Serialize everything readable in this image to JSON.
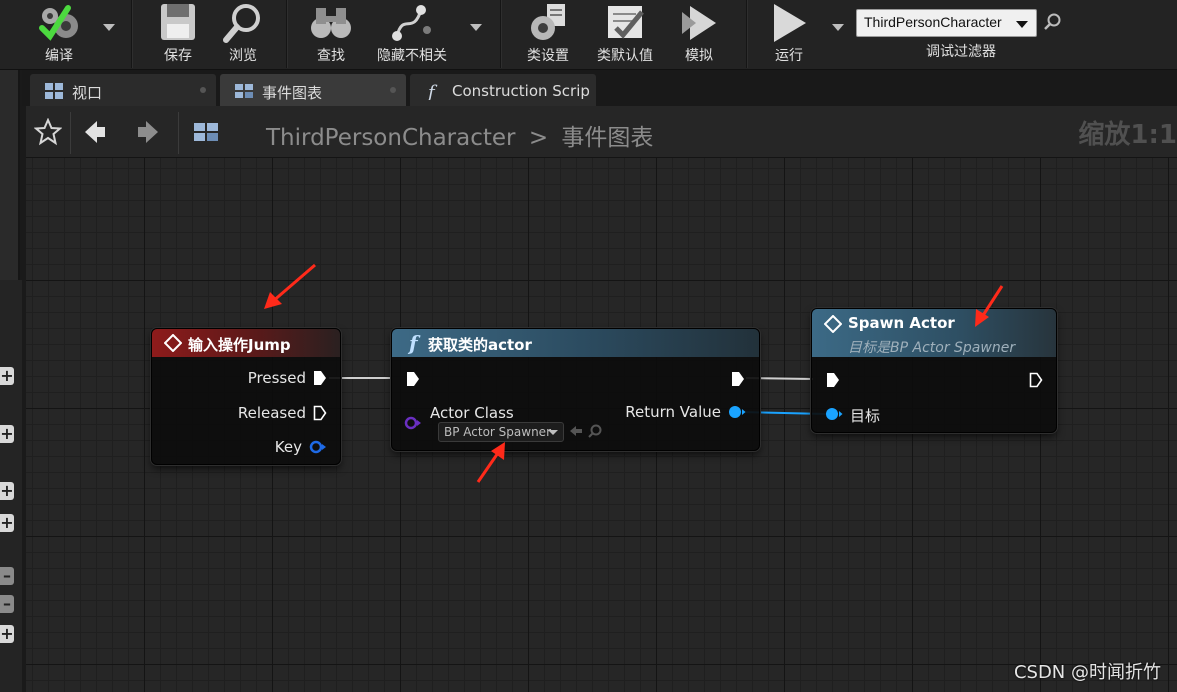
{
  "toolbar": {
    "compile": "编译",
    "save": "保存",
    "browse": "浏览",
    "find": "查找",
    "hide_unrelated": "隐藏不相关",
    "class_settings": "类设置",
    "class_defaults": "类默认值",
    "simulate": "模拟",
    "play": "运行",
    "debug_filter_value": "ThirdPersonCharacter",
    "debug_filter_label": "调试过滤器"
  },
  "tabs": [
    {
      "label": "视口",
      "icon": "viewport-icon"
    },
    {
      "label": "事件图表",
      "icon": "event-graph-icon"
    },
    {
      "label": "Construction Scrip",
      "icon": "function-icon"
    }
  ],
  "breadcrumb": {
    "root": "ThirdPersonCharacter",
    "separator": ">",
    "current": "事件图表",
    "zoom": "缩放1:1"
  },
  "nodes": {
    "input_jump": {
      "title": "输入操作Jump",
      "pins": {
        "pressed": "Pressed",
        "released": "Released",
        "key": "Key"
      }
    },
    "get_class_actor": {
      "title": "获取类的actor",
      "pins": {
        "actor_class": "Actor Class",
        "return_value": "Return Value"
      },
      "class_value": "BP Actor Spawner"
    },
    "spawn_actor": {
      "title": "Spawn Actor",
      "subtitle": "目标是BP Actor Spawner",
      "pins": {
        "target": "目标"
      }
    }
  },
  "colors": {
    "exec_pin": "#ffffff",
    "object_pin": "#1aa3ff",
    "class_pin": "#6a2fc2",
    "struct_pin": "#1e6ae6",
    "annotation_arrow": "#ff2a1a"
  },
  "watermark": "CSDN @时闻折竹"
}
